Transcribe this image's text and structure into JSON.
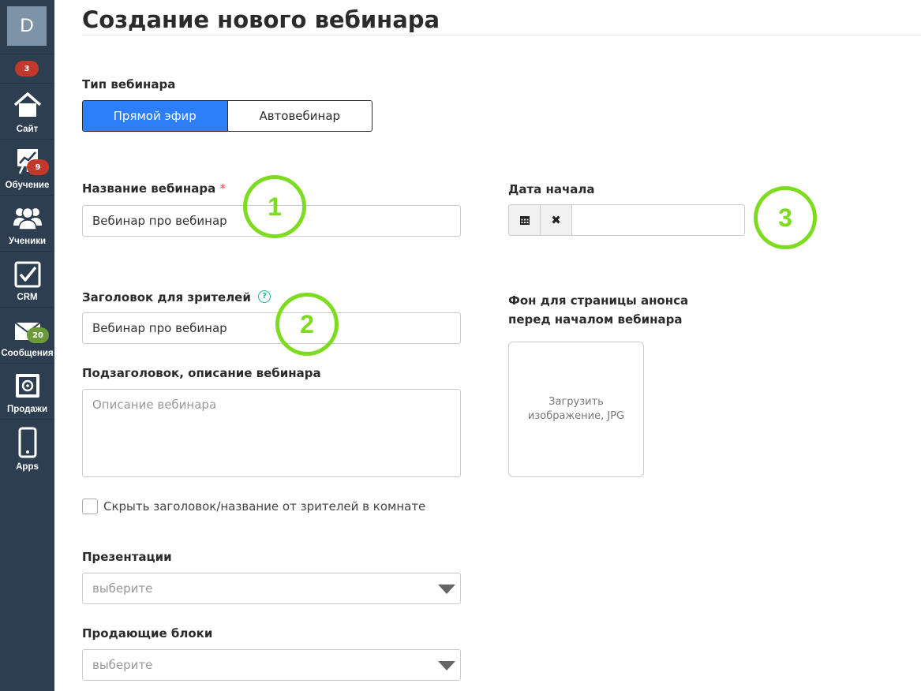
{
  "sidebar": {
    "avatar_letter": "D",
    "notifications_count": "3",
    "items": [
      {
        "label": "Сайт",
        "icon": "home-icon"
      },
      {
        "label": "Обучение",
        "icon": "chart-board-icon",
        "badge": "9",
        "badge_color": "#c0392b"
      },
      {
        "label": "Ученики",
        "icon": "users-icon"
      },
      {
        "label": "CRM",
        "icon": "checkbox-icon"
      },
      {
        "label": "Сообщения",
        "icon": "envelope-icon",
        "badge": "20",
        "badge_color": "#6a9a3a"
      },
      {
        "label": "Продажи",
        "icon": "safe-icon"
      },
      {
        "label": "Apps",
        "icon": "smartphone-icon"
      }
    ]
  },
  "page": {
    "title": "Создание нового вебинара"
  },
  "form": {
    "type_label": "Тип вебинара",
    "type_options": [
      "Прямой эфир",
      "Автовебинар"
    ],
    "type_selected": "Прямой эфир",
    "name_label": "Название вебинара",
    "name_required_mark": "*",
    "name_value": "Вебинар про вебинар",
    "start_date_label": "Дата начала",
    "start_date_value": "",
    "viewer_title_label": "Заголовок для зрителей",
    "viewer_title_help": "?",
    "viewer_title_value": "Вебинар про вебинар",
    "background_label_line1": "Фон для страницы анонса",
    "background_label_line2": "перед началом вебинара",
    "upload_text": "Загрузить изображение, JPG",
    "subtitle_label": "Подзаголовок, описание вебинара",
    "subtitle_placeholder": "Описание вебинара",
    "hide_title_label": "Скрыть заголовок/название от зрителей в комнате",
    "hide_title_checked": false,
    "presentations_label": "Презентации",
    "presentations_placeholder": "выберите",
    "selling_blocks_label": "Продающие блоки",
    "selling_blocks_placeholder": "выберите"
  },
  "annotations": [
    "1",
    "2",
    "3"
  ],
  "colors": {
    "sidebar_bg": "#2c3e50",
    "primary": "#2d7ff9",
    "annotation": "#7ddc1f",
    "required": "#e74c3c"
  }
}
